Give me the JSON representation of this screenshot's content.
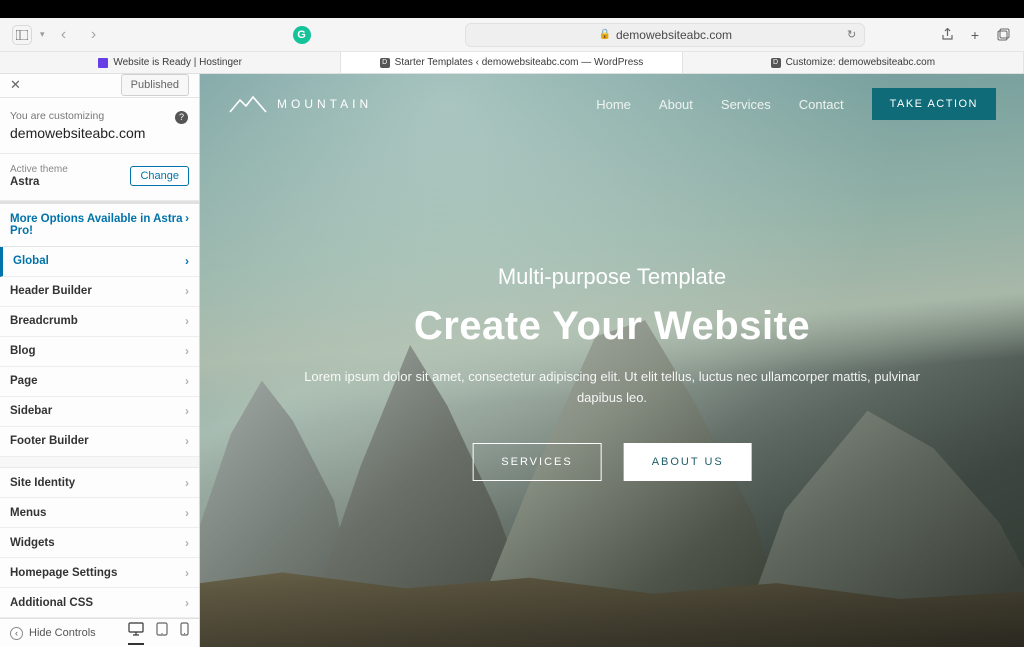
{
  "browser": {
    "url": "demowebsiteabc.com",
    "tabs": [
      {
        "label": "Website is Ready | Hostinger"
      },
      {
        "label": "Starter Templates ‹ demowebsiteabc.com — WordPress"
      },
      {
        "label": "Customize: demowebsiteabc.com"
      }
    ]
  },
  "panel": {
    "published_label": "Published",
    "customizing_label": "You are customizing",
    "site_name": "demowebsiteabc.com",
    "active_theme_label": "Active theme",
    "active_theme": "Astra",
    "change_label": "Change",
    "upsell": "More Options Available in Astra Pro!",
    "items_a": [
      "Global",
      "Header Builder",
      "Breadcrumb",
      "Blog",
      "Page",
      "Sidebar",
      "Footer Builder"
    ],
    "items_b": [
      "Site Identity",
      "Menus",
      "Widgets",
      "Homepage Settings",
      "Additional CSS"
    ],
    "hide_controls": "Hide Controls"
  },
  "preview": {
    "logo": "MOUNTAIN",
    "nav": [
      "Home",
      "About",
      "Services",
      "Contact"
    ],
    "cta": "TAKE ACTION",
    "tagline": "Multi-purpose Template",
    "headline": "Create Your Website",
    "desc": "Lorem ipsum dolor sit amet, consectetur adipiscing elit. Ut elit tellus, luctus nec ullamcorper mattis, pulvinar dapibus leo.",
    "btn1": "SERVICES",
    "btn2": "ABOUT US"
  }
}
